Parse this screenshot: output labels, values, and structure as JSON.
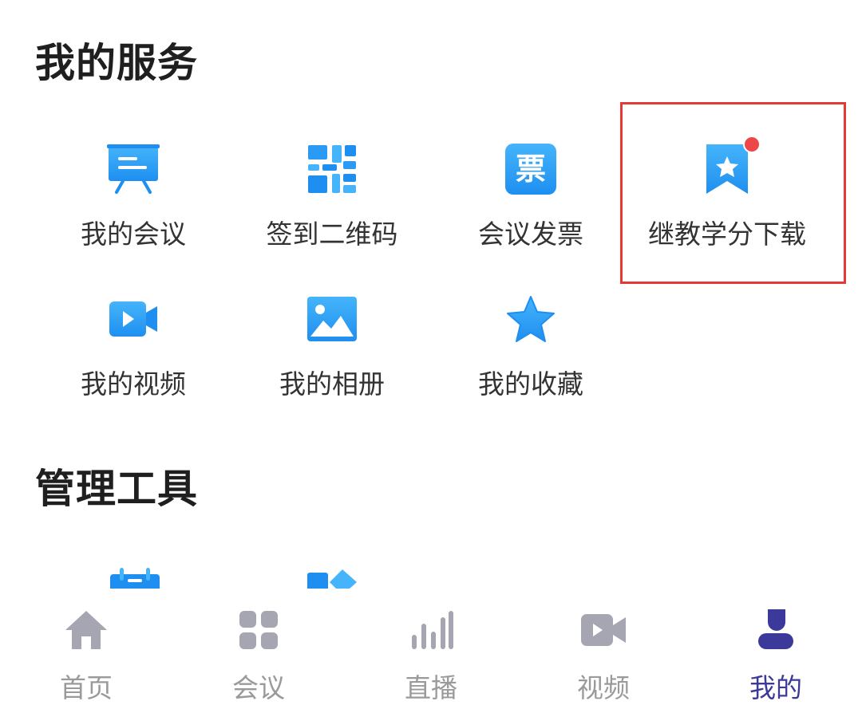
{
  "services": {
    "title": "我的服务",
    "items": [
      {
        "label": "我的会议",
        "icon": "meeting-board-icon"
      },
      {
        "label": "签到二维码",
        "icon": "qr-code-icon"
      },
      {
        "label": "会议发票",
        "icon": "invoice-icon",
        "icon_text": "票"
      },
      {
        "label": "继教学分下载",
        "icon": "bookmark-star-icon",
        "badge": true
      },
      {
        "label": "我的视频",
        "icon": "video-camera-icon"
      },
      {
        "label": "我的相册",
        "icon": "photo-album-icon"
      },
      {
        "label": "我的收藏",
        "icon": "star-icon"
      }
    ]
  },
  "tools": {
    "title": "管理工具",
    "items": [
      {
        "icon": "calendar-icon"
      },
      {
        "icon": "shapes-icon"
      }
    ]
  },
  "tabbar": {
    "active": "我的",
    "tabs": [
      {
        "label": "首页",
        "icon": "home-icon"
      },
      {
        "label": "会议",
        "icon": "grid-icon"
      },
      {
        "label": "直播",
        "icon": "live-bars-icon"
      },
      {
        "label": "视频",
        "icon": "video-icon"
      },
      {
        "label": "我的",
        "icon": "user-icon"
      }
    ]
  },
  "colors": {
    "accent_blue": "#1e8ff0",
    "icon_light_blue": "#45b4fb",
    "highlight_red": "#e53935",
    "badge_red": "#ee4747",
    "tab_inactive": "#9a9a9a",
    "tab_active": "#3b3a9a"
  }
}
